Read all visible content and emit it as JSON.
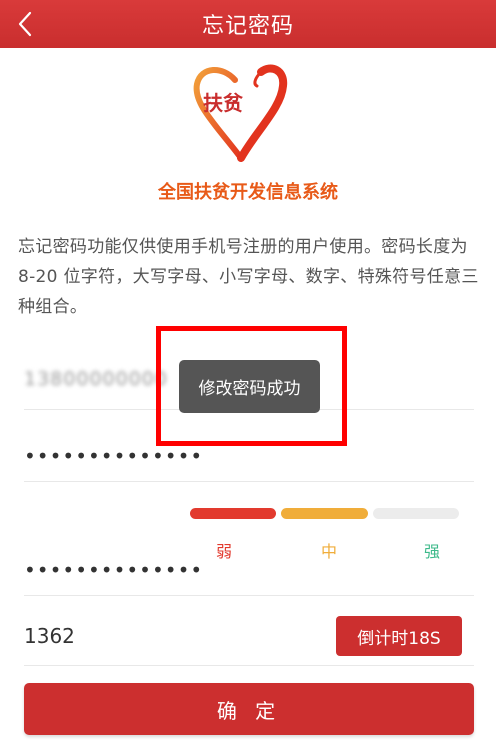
{
  "header": {
    "title": "忘记密码",
    "back_icon": "chevron-left-icon"
  },
  "logo": {
    "text": "扶贫"
  },
  "system_name": "全国扶贫开发信息系统",
  "intro_text": "忘记密码功能仅供使用手机号注册的用户使用。密码长度为8-20 位字符，大写字母、小写字母、数字、特殊符号任意三种组合。",
  "form": {
    "phone_value": "13800000000",
    "password_dots": "••••••••••••••",
    "confirm_password_dots": "••••••••••••••",
    "strength": {
      "weak_label": "弱",
      "mid_label": "中",
      "strong_label": "强",
      "level": 2
    },
    "code_value": "1362",
    "countdown_label": "倒计时18S",
    "confirm_label": "确 定"
  },
  "toast": {
    "message": "修改密码成功"
  },
  "colors": {
    "brand_red": "#cc2f2f",
    "weak": "#e23a2e",
    "mid": "#f0ad3a",
    "strong": "#3cb98a",
    "highlight": "#ff0000"
  }
}
